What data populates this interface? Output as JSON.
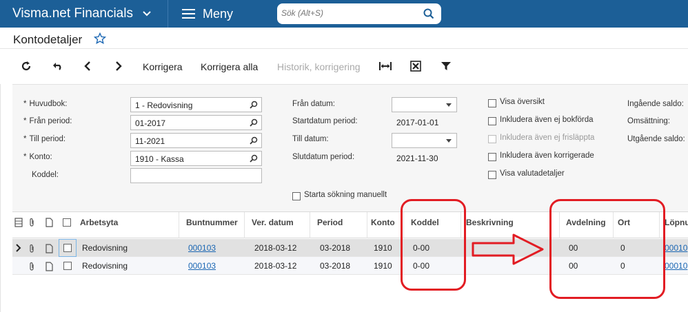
{
  "topbar": {
    "brand": "Visma.net Financials",
    "menu_label": "Meny",
    "search_placeholder": "Sök (Alt+S)"
  },
  "page": {
    "title": "Kontodetaljer"
  },
  "toolbar": {
    "korrigera": "Korrigera",
    "korrigera_alla": "Korrigera alla",
    "historik": "Historik, korrigering"
  },
  "form": {
    "huvudbok_label": "Huvudbok:",
    "huvudbok_value": "1 - Redovisning",
    "fran_period_label": "Från period:",
    "fran_period_value": "01-2017",
    "till_period_label": "Till period:",
    "till_period_value": "11-2021",
    "konto_label": "Konto:",
    "konto_value": "1910 - Kassa",
    "koddel_label": "Koddel:",
    "koddel_value": "",
    "fran_datum_label": "Från datum:",
    "startdatum_label": "Startdatum period:",
    "startdatum_value": "2017-01-01",
    "till_datum_label": "Till datum:",
    "slutdatum_label": "Slutdatum period:",
    "slutdatum_value": "2021-11-30",
    "starta_sokning": "Starta sökning manuellt",
    "checkboxes": {
      "visa_oversikt": "Visa översikt",
      "ej_bokforda": "Inkludera även ej bokförda",
      "ej_frislappta": "Inkludera även ej frisläppta",
      "korrigerade": "Inkludera även korrigerade",
      "valutadetaljer": "Visa valutadetaljer"
    },
    "ingaende_saldo": "Ingående saldo:",
    "omsattning": "Omsättning:",
    "utgaende_saldo": "Utgående saldo:"
  },
  "grid": {
    "headers": {
      "arbetsyta": "Arbetsyta",
      "buntnummer": "Buntnummer",
      "ver_datum": "Ver. datum",
      "period": "Period",
      "konto": "Konto",
      "koddel": "Koddel",
      "beskrivning": "Beskrivning",
      "avdelning": "Avdelning",
      "ort": "Ort",
      "lopnummer": "Löpnu"
    },
    "rows": [
      {
        "arbetsyta": "Redovisning",
        "buntnummer": "000103",
        "ver_datum": "2018-03-12",
        "period": "03-2018",
        "konto": "1910",
        "koddel": "0-00",
        "avdelning": "00",
        "ort": "0",
        "lopnummer": "00010"
      },
      {
        "arbetsyta": "Redovisning",
        "buntnummer": "000103",
        "ver_datum": "2018-03-12",
        "period": "03-2018",
        "konto": "1910",
        "koddel": "0-00",
        "avdelning": "00",
        "ort": "0",
        "lopnummer": "00010"
      }
    ]
  },
  "colors": {
    "topbar": "#1c5f97",
    "accent": "#1a66b3",
    "annotation": "#e21c23"
  }
}
